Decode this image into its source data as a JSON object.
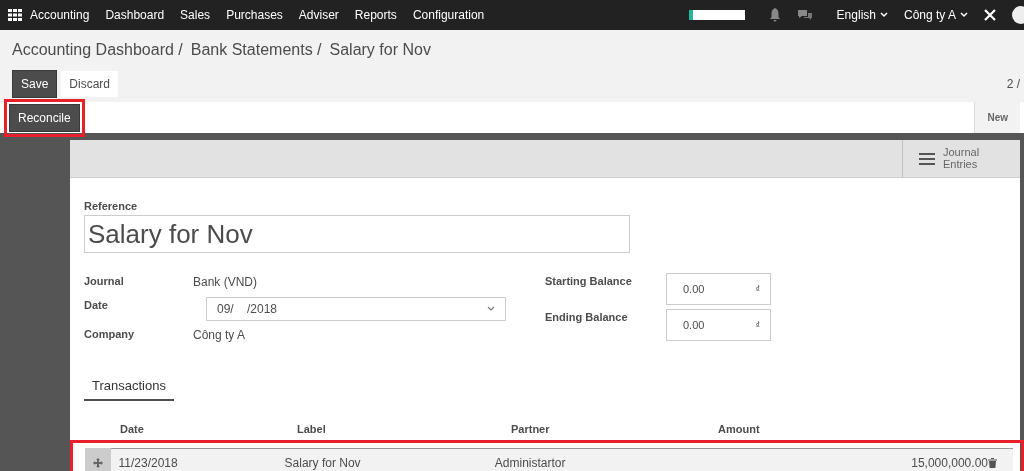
{
  "navbar": {
    "app": "Accounting",
    "menu": [
      "Dashboard",
      "Sales",
      "Purchases",
      "Adviser",
      "Reports",
      "Configuration"
    ],
    "language": "English",
    "company": "Công ty A",
    "progress": {
      "level": 0.08
    }
  },
  "breadcrumb": [
    "Accounting Dashboard /",
    "Bank Statements /",
    "Salary for Nov"
  ],
  "buttons": {
    "save": "Save",
    "discard": "Discard"
  },
  "pager": "2 /",
  "statusbar": {
    "reconcile": {
      "label": "Reconcile",
      "highlighted": true
    },
    "stages": [
      {
        "label": "New",
        "selected": true
      }
    ]
  },
  "sheet_buttons": [
    {
      "label_lines": [
        "Journal",
        "Entries"
      ]
    }
  ],
  "form": {
    "reference_label": "Reference",
    "reference": "Salary for Nov",
    "left": [
      {
        "label": "Journal",
        "kind": "text",
        "value": "Bank (VND)"
      },
      {
        "label": "Date",
        "kind": "select",
        "value": "09/    /2018"
      },
      {
        "label": "Company",
        "kind": "text",
        "value": "Công ty A"
      }
    ],
    "right": [
      {
        "label": "Starting Balance",
        "value": "0.00",
        "currency": "₫"
      },
      {
        "label": "Ending Balance",
        "value": "0.00",
        "currency": "₫"
      }
    ]
  },
  "tabs": [
    {
      "label": "Transactions",
      "selected": true
    }
  ],
  "table": {
    "columns": [
      "Date",
      "Label",
      "Partner",
      "Amount"
    ],
    "rows": [
      {
        "date": "11/23/2018",
        "label": "Salary for Nov",
        "partner": "Administartor",
        "amount": "15,000,000.00",
        "highlighted": true
      }
    ]
  }
}
